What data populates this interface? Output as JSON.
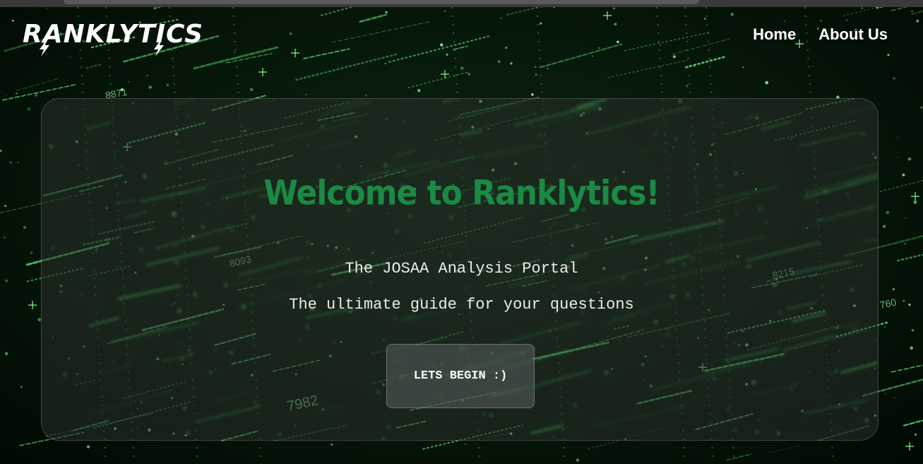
{
  "header": {
    "logo_text": "RANKLYTICS",
    "nav": [
      {
        "label": "Home"
      },
      {
        "label": "About Us"
      }
    ]
  },
  "hero": {
    "title": "Welcome to Ranklytics!",
    "subtitle": "The JOSAA Analysis Portal",
    "tagline": "The ultimate guide for your questions",
    "cta_label": "LETS BEGIN :)"
  },
  "background": {
    "numbers": [
      "8871",
      "8215",
      "760",
      "7982",
      "8093"
    ],
    "colors": {
      "base": "#031006",
      "dots": "#6dff8a",
      "title": "#1a8a44"
    }
  }
}
